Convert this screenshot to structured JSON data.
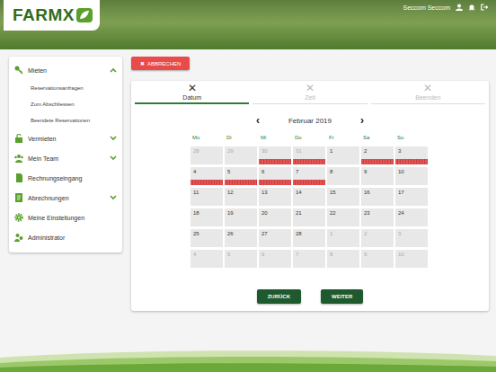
{
  "header": {
    "logo": "FARMX",
    "user": "Seccom Seccom"
  },
  "sidebar": {
    "items": [
      {
        "label": "Mieten",
        "expandable": true,
        "expanded": true,
        "children": [
          "Reservationsanfragen",
          "Zum Abschliessen",
          "Beendete Reservationen"
        ]
      },
      {
        "label": "Vermieten",
        "expandable": true,
        "expanded": false,
        "children": []
      },
      {
        "label": "Mein Team",
        "expandable": true,
        "expanded": false,
        "children": []
      },
      {
        "label": "Rechnungseingang",
        "expandable": false,
        "expanded": false,
        "children": []
      },
      {
        "label": "Abrechnungen",
        "expandable": true,
        "expanded": false,
        "children": []
      },
      {
        "label": "Meine Einstellungen",
        "expandable": false,
        "expanded": false,
        "children": []
      },
      {
        "label": "Administrator",
        "expandable": false,
        "expanded": false,
        "children": []
      }
    ]
  },
  "cancel": {
    "icon": "✖",
    "label": "ABBRECHEN"
  },
  "steps": [
    {
      "icon": "✕",
      "label": "Datum",
      "selected": true,
      "disabled": false
    },
    {
      "icon": "✕",
      "label": "Zeit",
      "selected": false,
      "disabled": true
    },
    {
      "icon": "✕",
      "label": "Beenden",
      "selected": false,
      "disabled": true
    }
  ],
  "calendar": {
    "prev": "‹",
    "next": "›",
    "month": "Februar 2019",
    "weekdays": [
      "Mo",
      "Di",
      "Mi",
      "Do",
      "Fr",
      "Sa",
      "So"
    ],
    "days": [
      {
        "day": "28",
        "muted": true,
        "reserved": false
      },
      {
        "day": "29",
        "muted": true,
        "reserved": false
      },
      {
        "day": "30",
        "muted": true,
        "reserved": true
      },
      {
        "day": "31",
        "muted": true,
        "reserved": true
      },
      {
        "day": "1",
        "muted": false,
        "reserved": false
      },
      {
        "day": "2",
        "muted": false,
        "reserved": true
      },
      {
        "day": "3",
        "muted": false,
        "reserved": true
      },
      {
        "day": "4",
        "muted": false,
        "reserved": true
      },
      {
        "day": "5",
        "muted": false,
        "reserved": true
      },
      {
        "day": "6",
        "muted": false,
        "reserved": true
      },
      {
        "day": "7",
        "muted": false,
        "reserved": true
      },
      {
        "day": "8",
        "muted": false,
        "reserved": false
      },
      {
        "day": "9",
        "muted": false,
        "reserved": false
      },
      {
        "day": "10",
        "muted": false,
        "reserved": false
      },
      {
        "day": "11",
        "muted": false,
        "reserved": false
      },
      {
        "day": "12",
        "muted": false,
        "reserved": false
      },
      {
        "day": "13",
        "muted": false,
        "reserved": false
      },
      {
        "day": "14",
        "muted": false,
        "reserved": false
      },
      {
        "day": "15",
        "muted": false,
        "reserved": false
      },
      {
        "day": "16",
        "muted": false,
        "reserved": false
      },
      {
        "day": "17",
        "muted": false,
        "reserved": false
      },
      {
        "day": "18",
        "muted": false,
        "reserved": false
      },
      {
        "day": "19",
        "muted": false,
        "reserved": false
      },
      {
        "day": "20",
        "muted": false,
        "reserved": false
      },
      {
        "day": "21",
        "muted": false,
        "reserved": false
      },
      {
        "day": "22",
        "muted": false,
        "reserved": false
      },
      {
        "day": "23",
        "muted": false,
        "reserved": false
      },
      {
        "day": "24",
        "muted": false,
        "reserved": false
      },
      {
        "day": "25",
        "muted": false,
        "reserved": false
      },
      {
        "day": "26",
        "muted": false,
        "reserved": false
      },
      {
        "day": "27",
        "muted": false,
        "reserved": false
      },
      {
        "day": "28",
        "muted": false,
        "reserved": false
      },
      {
        "day": "1",
        "muted": true,
        "reserved": false
      },
      {
        "day": "2",
        "muted": true,
        "reserved": false
      },
      {
        "day": "3",
        "muted": true,
        "reserved": false
      },
      {
        "day": "4",
        "muted": true,
        "reserved": false
      },
      {
        "day": "5",
        "muted": true,
        "reserved": false
      },
      {
        "day": "6",
        "muted": true,
        "reserved": false
      },
      {
        "day": "7",
        "muted": true,
        "reserved": false
      },
      {
        "day": "8",
        "muted": true,
        "reserved": false
      },
      {
        "day": "9",
        "muted": true,
        "reserved": false
      },
      {
        "day": "10",
        "muted": true,
        "reserved": false
      }
    ]
  },
  "buttons": {
    "back": "ZURÜCK",
    "next": "WEITER"
  }
}
